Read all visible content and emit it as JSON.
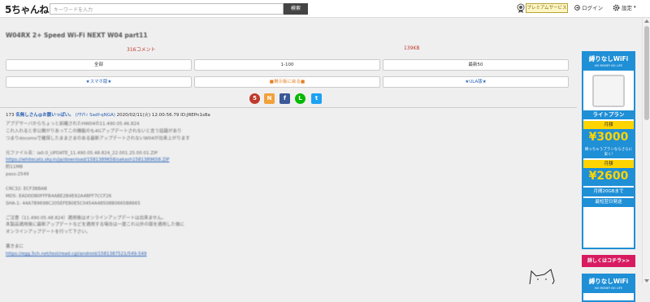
{
  "header": {
    "logo": "5ちゃんねる",
    "search_placeholder": "キーワードを入力",
    "search_button": "検索",
    "premium": "プレミアムサービス",
    "login": "ログイン",
    "settings": "設定"
  },
  "thread": {
    "title": "W04RX 2+ Speed Wi-Fi NEXT W04 part11",
    "comments": "316コメント",
    "size": "139KB"
  },
  "nav": {
    "all": "全部",
    "range": "1-100",
    "latest": "最新50",
    "smartphone": "★スマホ版★",
    "bulletin": "■掲示板に戻る■",
    "ula": "★ULA版★"
  },
  "share": {
    "icons": [
      "5ch-share-icon",
      "note-icon",
      "facebook-icon",
      "line-icon",
      "twitter-icon"
    ],
    "colors": [
      "#c0392b",
      "#f2a23a",
      "#3b5998",
      "#00b900",
      "#1da1f2"
    ]
  },
  "post": {
    "number": "173",
    "name": "名無しさん@お腹いっぱい。",
    "id_tag": "(ｱﾀﾏﾘｨ Sadf-qNGA)",
    "date": "2020/02/11(火) 12:00:56.79",
    "uid": "ID:JREPn1s8a",
    "lines": [
      "アプデサーバからちょっと前確されたHW04の11.490.05.46.824",
      "これ入れると非公開がりあってこの機能のも4Gアップデートされないと言う話題があり",
      "つまりdocomoで確保したままさまのある最新アップデートされないW04が出来上がります",
      "",
      "元ファイル名：ia0.0_UPDATE_11.490.05.48.824_22.001.25.00.01.ZIP",
      "https://whitecats.sky.in/ja/download/1581389658/sakash1581389658.ZIP",
      "約11MB",
      "pass:2549",
      "",
      "CRC32: ECF3BBAB",
      "MD5: EAD0DB0FFFB4ABE2B4E92A4BFF7CCF26",
      "SHA-1: 44A7B9698C205EFEB0E5C0454A48508B0665B8665",
      "",
      "ご注意（11.490.05.48.824）適用後はオンラインアップデートは出来ません。",
      "本製品適用後に最新アップデートなどを適用する場合は一度これ以外の版を適用した後に",
      "オンラインアップデートを行って下さい。",
      "",
      "書きまに",
      "https://egg.5ch.net/test/read.cgi/android/1581387521/549-549"
    ]
  },
  "sidebar": {
    "ad_title": "縛りなしWiFi",
    "ad_subtitle": "NO MONEY NO LIFE",
    "plan": "ライトプラン",
    "month1": "月額",
    "price1": "¥3000",
    "note1": "縛っちゃうプランならさらに安く!",
    "month2": "月額",
    "price2": "¥2600",
    "feature1": "月間20GBまで",
    "feature2": "最短翌日発送",
    "cta": "詳しくはコチラ>>",
    "ad2_title": "縛りなしWiFi",
    "ad2_subtitle": "NO MONEY NO LIFE"
  }
}
